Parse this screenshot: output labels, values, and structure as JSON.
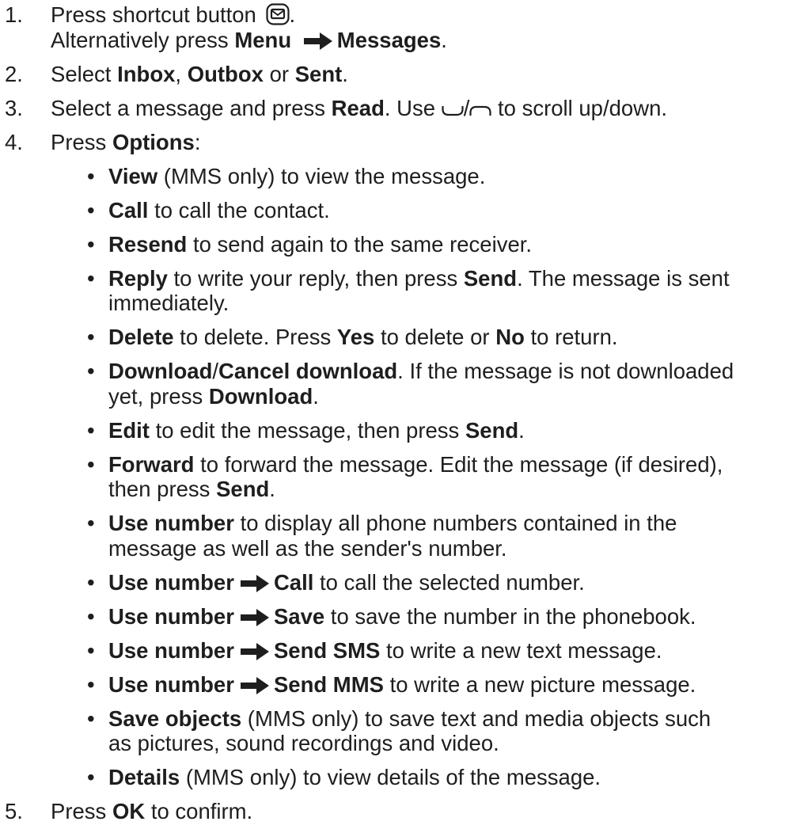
{
  "steps": [
    {
      "number": "1.",
      "press": "Press shortcut button",
      "period": ".",
      "alt_pre": "Alternatively press",
      "alt_menu": "Menu",
      "alt_messages": "Messages",
      "alt_period": "."
    },
    {
      "number": "2.",
      "pre": "Select",
      "inbox": "Inbox",
      "comma": ",",
      "outbox": "Outbox",
      "or": "or",
      "sent": "Sent",
      "period": "."
    },
    {
      "number": "3.",
      "pre": "Select a message and press",
      "read": "Read",
      "use": ". Use",
      "slash": "/",
      "post": "to scroll up/down."
    },
    {
      "number": "4.",
      "pre": "Press",
      "options": "Options",
      "colon": ":"
    },
    {
      "number": "5.",
      "pre": "Press",
      "ok": "OK",
      "post": "to confirm."
    }
  ],
  "options": [
    {
      "bold": "View",
      "text": " (MMS only) to view the message."
    },
    {
      "bold": "Call",
      "text": " to call the contact."
    },
    {
      "bold": "Resend",
      "text": " to send again to the same receiver."
    },
    {
      "bold": "Reply",
      "text": " to write your reply, then press ",
      "bold2": "Send",
      "text2": ". The message is sent",
      "cont": "immediately."
    },
    {
      "bold": "Delete",
      "text": " to delete. Press ",
      "bold2": "Yes",
      "text2": " to delete or ",
      "bold3": "No",
      "text3": " to return."
    },
    {
      "bold": "Download",
      "text": "/",
      "bold2": "Cancel download",
      "text2": ". If the message is not downloaded",
      "cont_pre": "yet, press ",
      "cont_bold": "Download",
      "cont_post": "."
    },
    {
      "bold": "Edit",
      "text": " to edit the message, then press ",
      "bold2": "Send",
      "text2": "."
    },
    {
      "bold": "Forward",
      "text": " to forward the message. Edit the message (if desired),",
      "cont_pre": "then press ",
      "cont_bold": "Send",
      "cont_post": "."
    },
    {
      "bold": "Use number",
      "text": " to display all phone numbers contained in the",
      "cont": "message as well as the sender's number."
    },
    {
      "bold": "Use number",
      "bold2": "Call",
      "text2": " to call the selected number."
    },
    {
      "bold": "Use number",
      "bold2": "Save",
      "text2": " to save the number in the phonebook."
    },
    {
      "bold": "Use number",
      "bold2": "Send SMS",
      "text2": " to write a new text message."
    },
    {
      "bold": "Use number",
      "bold2": "Send MMS",
      "text2": " to write a new picture message."
    },
    {
      "bold": "Save objects",
      "text": " (MMS only) to save text and media objects such",
      "cont": "as pictures, sound recordings and video."
    },
    {
      "bold": "Details",
      "text": " (MMS only) to view details of the message."
    }
  ],
  "bullet_char": "•"
}
